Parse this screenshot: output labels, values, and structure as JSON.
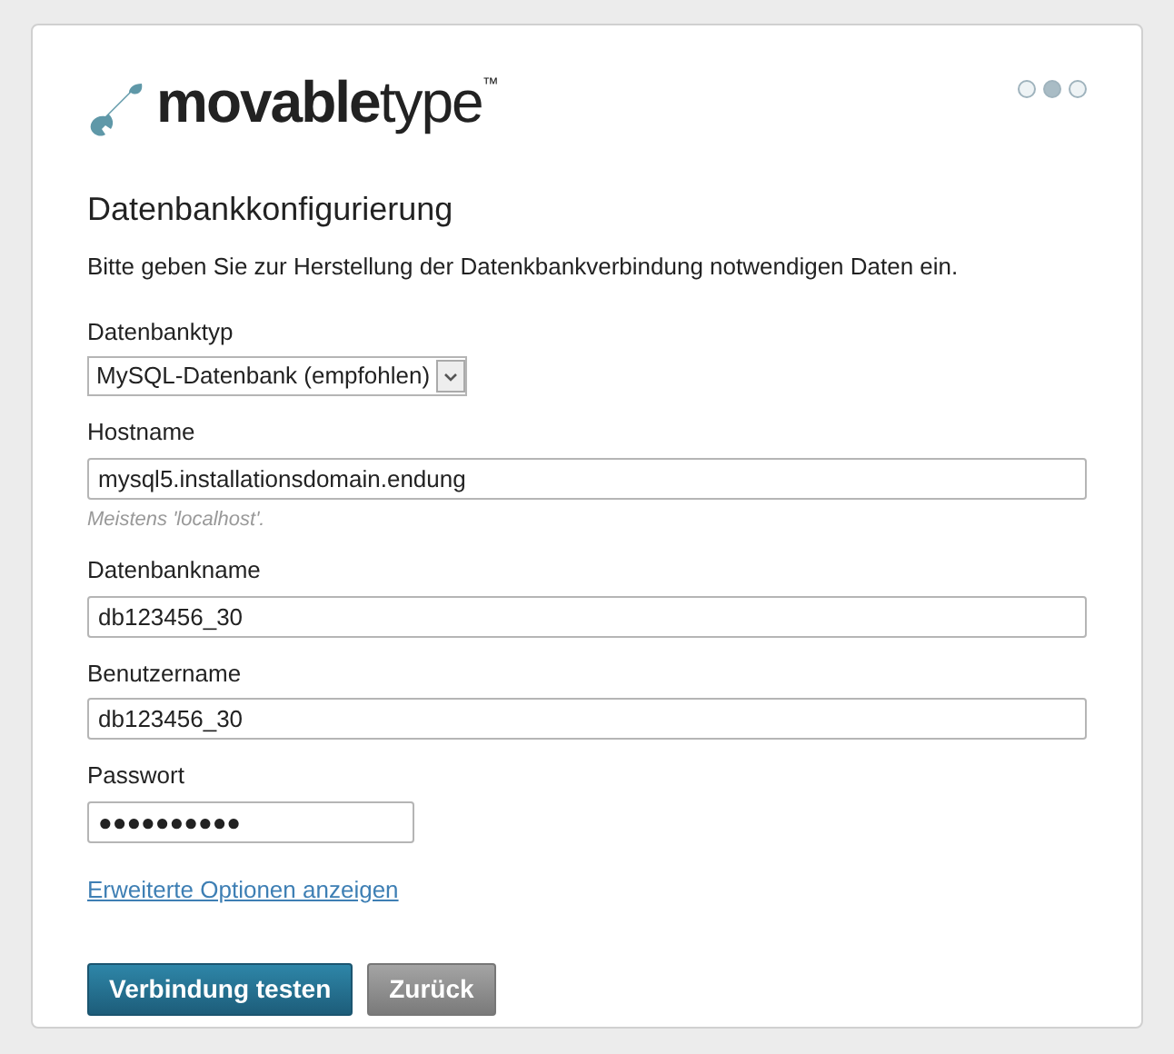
{
  "logo": {
    "text": "**movable**type",
    "trademark": "™"
  },
  "steps": [
    {
      "selected": false
    },
    {
      "selected": true
    },
    {
      "selected": false
    }
  ],
  "heading": "Datenbankkonfigurierung",
  "intro": "Bitte geben Sie zur Herstellung der Datenkbankverbindung notwendigen Daten ein.",
  "fields": [
    {
      "kind": "select",
      "label": "Datenbanktyp",
      "value": "MySQL-Datenbank (empfohlen)"
    },
    {
      "kind": "text",
      "label": "Hostname",
      "value": "mysql5.installationsdomain.endung",
      "hint": "Meistens 'localhost'."
    },
    {
      "kind": "text",
      "label": "Datenbankname",
      "value": "db123456_30"
    },
    {
      "kind": "text",
      "label": "Benutzername",
      "value": "db123456_30"
    },
    {
      "kind": "password",
      "label": "Passwort",
      "value": "●●●●●●●●●●"
    }
  ],
  "advanced_link": "Erweiterte Optionen anzeigen",
  "buttons": [
    {
      "kind": "primary",
      "label": "Verbindung testen"
    },
    {
      "kind": "secondary",
      "label": "Zurück"
    }
  ]
}
